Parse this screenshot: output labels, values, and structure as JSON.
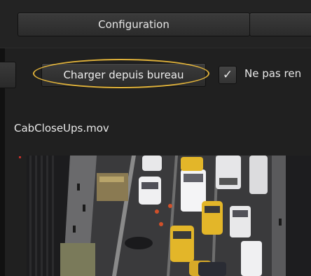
{
  "tabs": [
    {
      "label": "Configuration"
    },
    {
      "label": ""
    }
  ],
  "toolbar": {
    "load_button_label": "Charger depuis bureau",
    "checkbox_checked": true,
    "checkbox_label": "Ne pas ren"
  },
  "media": {
    "filename": "CabCloseUps.mov"
  },
  "colors": {
    "highlight_ring": "#e0b23a",
    "background": "#202020",
    "taxi_yellow": "#e3b629"
  },
  "icons": {
    "checkmark": "check-icon"
  }
}
